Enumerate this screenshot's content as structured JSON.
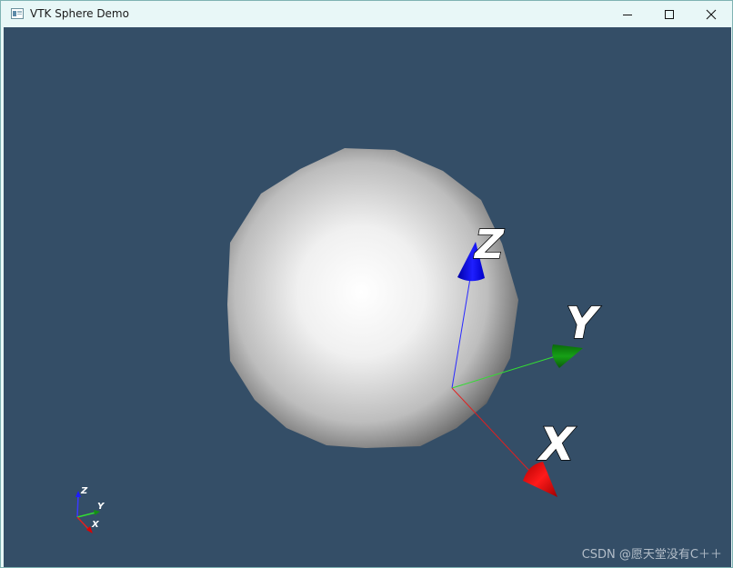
{
  "window": {
    "title": "VTK Sphere Demo",
    "minimize_icon": "minimize-icon",
    "maximize_icon": "maximize-icon",
    "close_icon": "close-icon"
  },
  "viewport": {
    "background": "#344e67",
    "object": "sphere"
  },
  "axes": {
    "x_label": "X",
    "y_label": "Y",
    "z_label": "Z",
    "x_color": "#ff0000",
    "y_color": "#00cc00",
    "z_color": "#0000ff"
  },
  "orientation_widget": {
    "x_label": "X",
    "y_label": "Y",
    "z_label": "Z"
  },
  "watermark": "CSDN @愿天堂没有C＋＋"
}
